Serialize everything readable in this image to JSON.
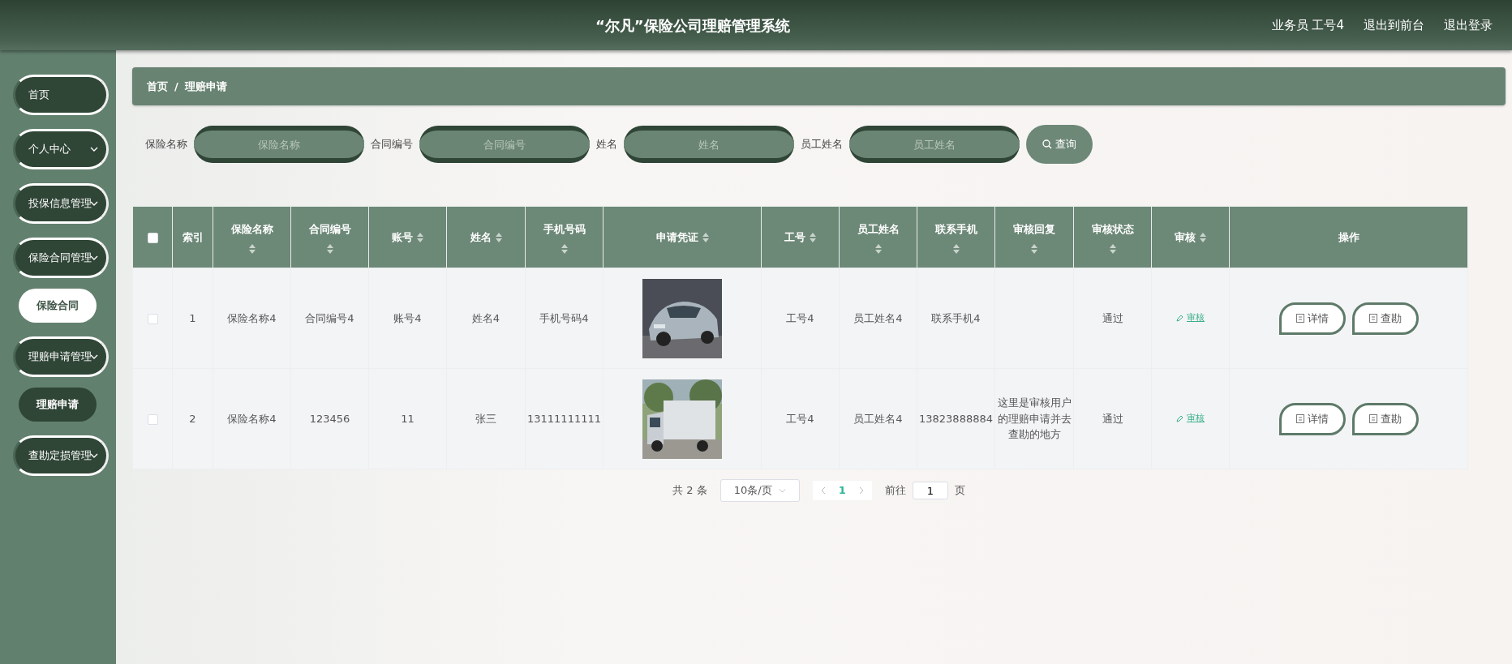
{
  "header": {
    "title": "“尔凡”保险公司理赔管理系统",
    "user": "业务员 工号4",
    "links": [
      "退出到前台",
      "退出登录"
    ]
  },
  "sidebar": {
    "items": [
      {
        "label": "首页",
        "kind": "link"
      },
      {
        "label": "个人中心",
        "kind": "menu"
      },
      {
        "label": "投保信息管理",
        "kind": "menu"
      },
      {
        "label": "保险合同管理",
        "kind": "menu",
        "children": [
          {
            "label": "保险合同",
            "selected": true
          }
        ]
      },
      {
        "label": "理赔申请管理",
        "kind": "menu",
        "children": [
          {
            "label": "理赔申请",
            "selected": false
          }
        ]
      },
      {
        "label": "查勘定损管理",
        "kind": "menu"
      }
    ]
  },
  "breadcrumb": {
    "items": [
      "首页",
      "理赔申请"
    ],
    "separator": "/"
  },
  "filters": [
    {
      "label": "保险名称",
      "placeholder": "保险名称"
    },
    {
      "label": "合同编号",
      "placeholder": "合同编号"
    },
    {
      "label": "姓名",
      "placeholder": "姓名"
    },
    {
      "label": "员工姓名",
      "placeholder": "员工姓名"
    }
  ],
  "search_button": "查询",
  "table": {
    "select_all": {
      "checked": false
    },
    "columns": [
      {
        "label": "索引",
        "sortable": false,
        "kind": "text"
      },
      {
        "label": "保险名称",
        "sortable": true,
        "kind": "text"
      },
      {
        "label": "合同编号",
        "sortable": true,
        "kind": "text"
      },
      {
        "label": "账号",
        "sortable": true,
        "kind": "text"
      },
      {
        "label": "姓名",
        "sortable": true,
        "kind": "text"
      },
      {
        "label": "手机号码",
        "sortable": true,
        "kind": "text"
      },
      {
        "label": "申请凭证",
        "sortable": true
      },
      {
        "label": "工号",
        "sortable": true,
        "kind": "text"
      },
      {
        "label": "员工姓名",
        "sortable": true,
        "kind": "text"
      },
      {
        "label": "联系手机",
        "sortable": true,
        "kind": "text"
      },
      {
        "label": "审核回复",
        "sortable": true,
        "kind": "text"
      },
      {
        "label": "审核状态",
        "sortable": true,
        "kind": "text"
      },
      {
        "label": "审核",
        "sortable": true,
        "kind": "action"
      },
      {
        "label": "操作",
        "sortable": false,
        "kind": "buttons"
      }
    ],
    "rows": [
      {
        "checked": false,
        "cells": [
          "1",
          "保险名称4",
          "合同编号4",
          "账号4",
          "姓名4",
          "手机号码4",
          {
            "kind": "picture"
          },
          "工号4",
          "员工姓名4",
          "联系手机4",
          "",
          "通过",
          "审核",
          [
            "详情",
            "查勘"
          ]
        ]
      },
      {
        "checked": false,
        "cells": [
          "2",
          "保险名称4",
          "123456",
          "11",
          "张三",
          "13111111111",
          {
            "kind": "picture"
          },
          "工号4",
          "员工姓名4",
          "13823888884",
          "这里是审核用户的理赔申请并去查勘的地方",
          "通过",
          "审核",
          [
            "详情",
            "查勘"
          ]
        ]
      }
    ]
  },
  "pagination": {
    "total": "共 2 条",
    "page_size": "10条/页",
    "pages": [
      {
        "label": "1",
        "selected": true
      }
    ],
    "goto_label": "前往",
    "goto_value": "1",
    "goto_suffix": "页"
  }
}
